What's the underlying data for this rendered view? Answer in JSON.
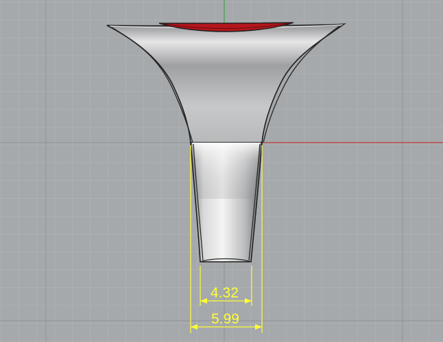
{
  "viewport": {
    "name": "front-viewport",
    "background": "#a5a9ac",
    "grid_minor_color": "#b3b6b9",
    "grid_major_color": "#92979b",
    "axis_x_color": "#c23a3a",
    "axis_y_color": "#3ea04a"
  },
  "model": {
    "object": "signet-ring-shank",
    "body_color": "#c9cacb",
    "edge_color": "#1e1e1e",
    "gem_color": "#b3171d"
  },
  "dimensions": {
    "color": "#ffff33",
    "inner_width": "4.32",
    "outer_width": "5.99"
  }
}
